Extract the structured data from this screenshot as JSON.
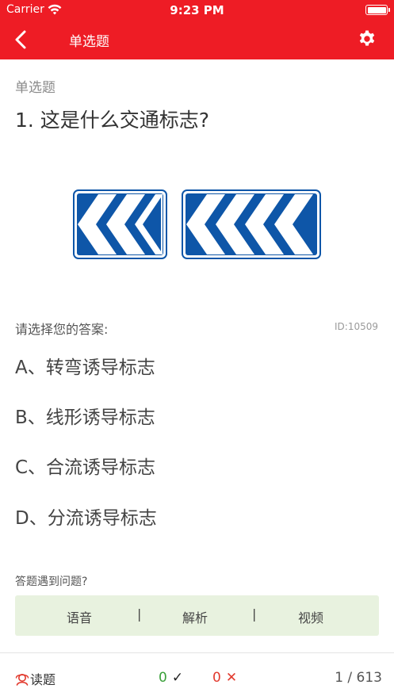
{
  "status_bar": {
    "carrier": "Carrier",
    "time": "9:23 PM"
  },
  "nav": {
    "title": "单选题",
    "back_icon": "chevron-left-icon",
    "settings_icon": "gear-icon"
  },
  "question": {
    "type_label": "单选题",
    "text": "1. 这是什么交通标志?",
    "prompt": "请选择您的答案:",
    "id_label": "ID:10509",
    "image": "chevron-alignment-signs"
  },
  "options": [
    {
      "label": "A、转弯诱导标志"
    },
    {
      "label": "B、线形诱导标志"
    },
    {
      "label": "C、合流诱导标志"
    },
    {
      "label": "D、分流诱导标志"
    }
  ],
  "problem_label": "答题遇到问题?",
  "toolbar": {
    "voice": "语音",
    "separator": "|",
    "analysis": "解析",
    "video": "视频"
  },
  "bottom": {
    "read_label": "读题",
    "correct_count": "0",
    "correct_mark": "✓",
    "wrong_count": "0",
    "wrong_mark": "✕",
    "progress": "1 / 613"
  },
  "colors": {
    "header": "#ee1c25",
    "toolbar_bg": "#e8f2df",
    "sign_blue": "#0e56a8",
    "correct": "#3aa03a",
    "wrong": "#e23a2e"
  }
}
